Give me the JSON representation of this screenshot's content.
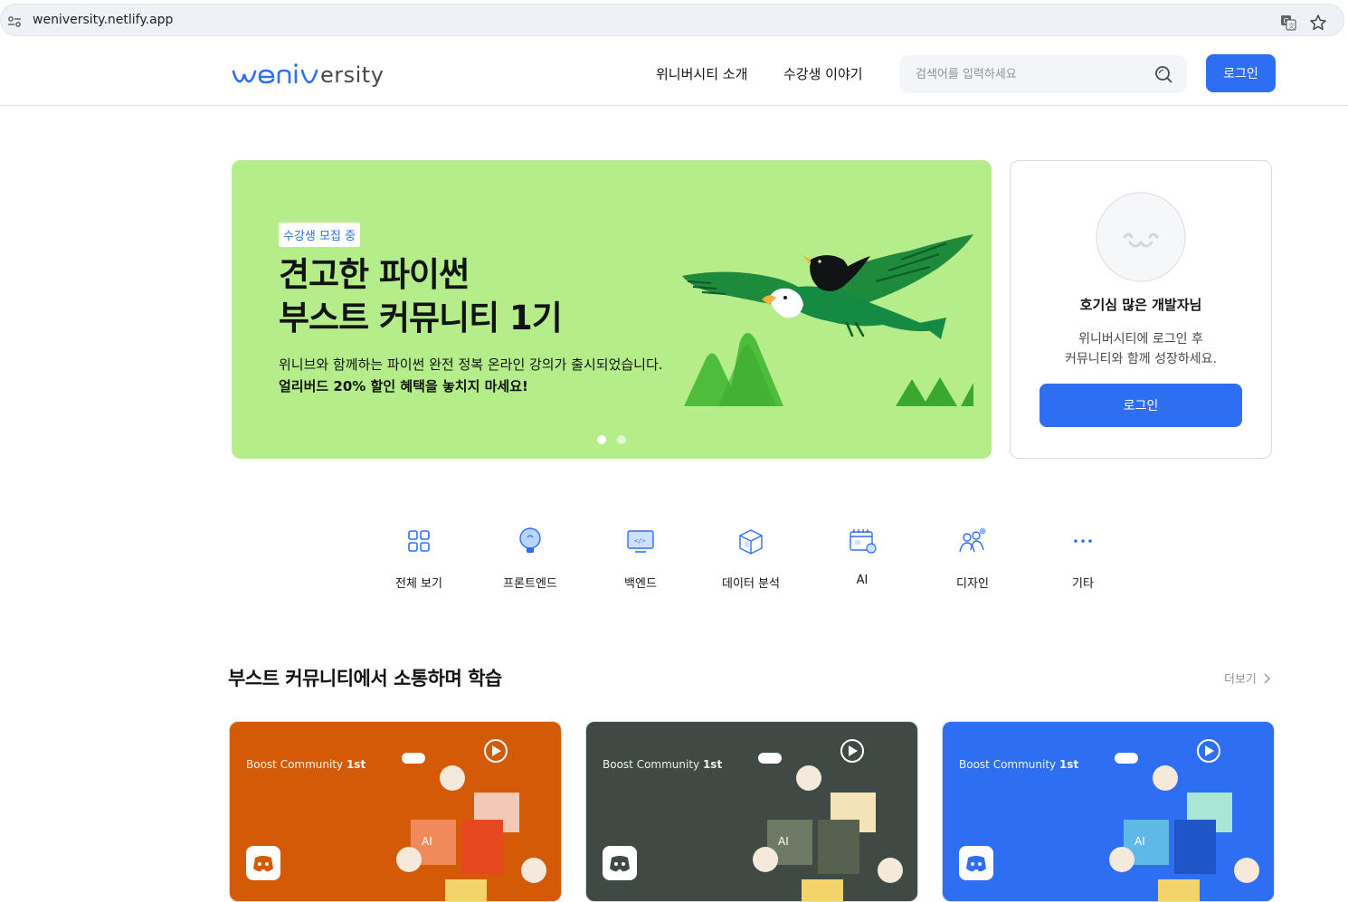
{
  "browser": {
    "url": "weniversity.netlify.app"
  },
  "header": {
    "logo_text": "weniversity",
    "nav": [
      "위니버시티 소개",
      "수강생 이야기"
    ],
    "search_placeholder": "검색어를 입력하세요",
    "login_label": "로그인"
  },
  "banner": {
    "badge": "수강생 모집 중",
    "title_line1": "견고한 파이썬",
    "title_line2": "부스트 커뮤니티 1기",
    "description": "위니브와 함께하는 파이썬 완전 정복 온라인 강의가 출시되었습니다.",
    "highlight": "얼리버드 20% 할인 혜택을 놓치지 마세요!",
    "slide_count": 2,
    "active_slide": 1,
    "bg_color": "#b4ed8a"
  },
  "profile": {
    "name": "호기심 많은 개발자님",
    "message_line1": "위니버시티에 로그인 후",
    "message_line2": "커뮤니티와 함께 성장하세요.",
    "login_label": "로그인"
  },
  "categories": [
    {
      "label": "전체 보기",
      "icon": "grid-icon"
    },
    {
      "label": "프론트엔드",
      "icon": "lightbulb-icon"
    },
    {
      "label": "백엔드",
      "icon": "monitor-code-icon"
    },
    {
      "label": "데이터 분석",
      "icon": "database-box-icon"
    },
    {
      "label": "AI",
      "icon": "calendar-ai-icon"
    },
    {
      "label": "디자인",
      "icon": "people-icon"
    },
    {
      "label": "기타",
      "icon": "more-dots-icon"
    }
  ],
  "section": {
    "title": "부스트 커뮤니티에서 소통하며 학습",
    "more_label": "더보기"
  },
  "courses": [
    {
      "label_prefix": "Boost Community ",
      "label_strong": "1st",
      "color": "#d35a06"
    },
    {
      "label_prefix": "Boost Community ",
      "label_strong": "1st",
      "color": "#3f4a44"
    },
    {
      "label_prefix": "Boost Community ",
      "label_strong": "1st",
      "color": "#2e6ff2"
    }
  ],
  "colors": {
    "primary": "#2e6ff2",
    "text": "#121314",
    "muted": "#8d9299"
  }
}
